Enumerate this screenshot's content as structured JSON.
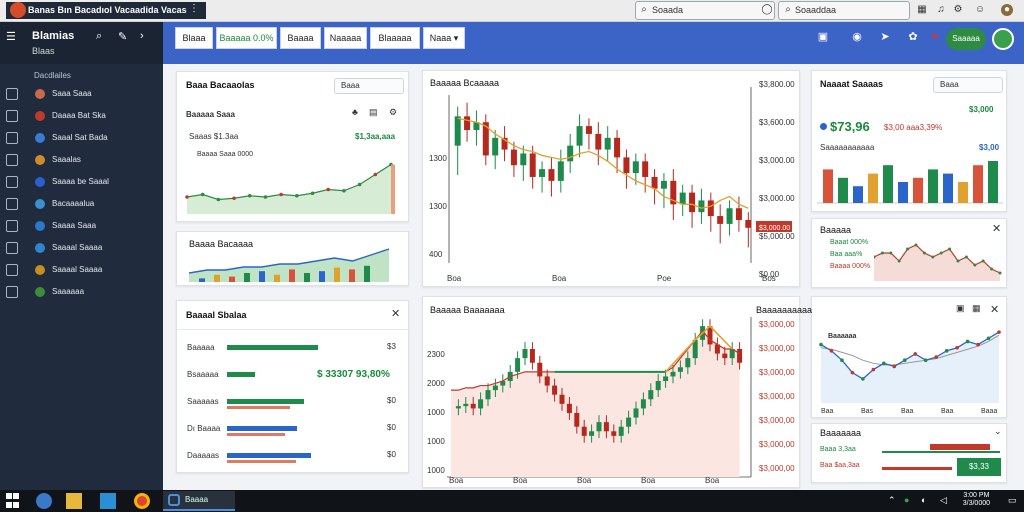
{
  "window": {
    "title": "Banas Bın Bacadıol Vacaadida Vacas"
  },
  "search": {
    "left": "Soaada",
    "right": "Soaaddaa"
  },
  "sidebar": {
    "title": "Blamias",
    "subtitle": "Blaas",
    "section": "Dacdlailes",
    "items": [
      {
        "label": "Saaa Saaa",
        "icon": "chart-icon",
        "color": "#c96a4a"
      },
      {
        "label": "Daaaa Bat Ska",
        "icon": "message-icon",
        "color": "#c0392b"
      },
      {
        "label": "Saaal Sat Bada",
        "icon": "key-icon",
        "color": "#3a7bd5"
      },
      {
        "label": "Saaalas",
        "icon": "calendar-icon",
        "color": "#d08a2a"
      },
      {
        "label": "Saaaa be Saaal",
        "icon": "bell-icon",
        "color": "#2c5fd0"
      },
      {
        "label": "Bacaaaalua",
        "icon": "grid-icon",
        "color": "#3a8fd0"
      },
      {
        "label": "Saaaa Saaa",
        "icon": "square-icon",
        "color": "#2a78c9"
      },
      {
        "label": "Saaaal Saaaa",
        "icon": "wrench-icon",
        "color": "#2d86cf"
      },
      {
        "label": "Saaaal Saaaa",
        "icon": "layers-icon",
        "color": "#c78f1f"
      },
      {
        "label": "Saaaaaa",
        "icon": "box-icon",
        "color": "#3e8d3a"
      }
    ]
  },
  "toolbar": {
    "tabs": [
      {
        "label": "Blaaa",
        "active": false
      },
      {
        "label": "Baaaaa 0.0%",
        "active": true
      },
      {
        "label": "Baaaa",
        "active": false
      },
      {
        "label": "Naaaaa",
        "active": false
      },
      {
        "label": "Blaaaaa",
        "active": false
      },
      {
        "label": "Naaa ▾",
        "active": false
      }
    ],
    "action_label": "Saaaaa",
    "icons": [
      "calendar-icon",
      "globe-icon",
      "send-icon",
      "leaf-icon"
    ]
  },
  "panel1": {
    "title": "Baaa Bacaaolas",
    "btn": "Baaa",
    "kpi_label": "Saaas $1.3aa",
    "kpi_value": "$1,3aa,aaa",
    "sub": "Baaaa Saaa 0000",
    "values": [
      12,
      14,
      10,
      11,
      13,
      12,
      14,
      13,
      15,
      18,
      17,
      22,
      30,
      38
    ]
  },
  "panel2": {
    "title": "Baaaa Bacaaaa",
    "bars": [
      2,
      4,
      3,
      5,
      6,
      4,
      7,
      5,
      6,
      8,
      7,
      9
    ],
    "line": [
      3,
      4,
      4,
      5,
      5,
      6,
      6,
      7,
      8,
      7,
      9,
      11
    ]
  },
  "panel3": {
    "title": "Baaaal Sbalaa",
    "rows": [
      {
        "label": "Baaaaa",
        "value": "$3",
        "pct": 0.65,
        "color": "#1e8a4b"
      },
      {
        "label": "Bsaaaaa",
        "value": "$ 33307 93,80%",
        "pct": 0.2,
        "color": "#1e8a4b"
      },
      {
        "label": "Saaaaas",
        "value": "$0",
        "pct": 0.55,
        "color": "#1e8a4b"
      },
      {
        "label": "Dı Baaaa",
        "value": "$0",
        "pct": 0.5,
        "color": "#2a66c9"
      },
      {
        "label": "Daaaaas",
        "value": "$0",
        "pct": 0.6,
        "color": "#2a66c9"
      }
    ]
  },
  "chart_main": {
    "title": "Baaaaa Bcaaaaa",
    "ylabels": [
      "$3,800.00",
      "$3,600.00",
      "$3,000.00",
      "$3,000.00",
      "$5,000.00",
      "$0.00"
    ],
    "left_labels": [
      "1300",
      "1300",
      "400",
      "0"
    ],
    "xlabels": [
      "Boa",
      "Boa",
      "Poe",
      "Bos"
    ],
    "price_tag": "$3,000.00",
    "candles": [
      [
        60,
        75,
        45,
        80
      ],
      [
        75,
        68,
        62,
        82
      ],
      [
        68,
        72,
        60,
        78
      ],
      [
        72,
        55,
        50,
        76
      ],
      [
        55,
        64,
        48,
        68
      ],
      [
        64,
        58,
        52,
        70
      ],
      [
        58,
        50,
        44,
        62
      ],
      [
        50,
        56,
        42,
        60
      ],
      [
        56,
        44,
        38,
        60
      ],
      [
        44,
        48,
        36,
        52
      ],
      [
        48,
        42,
        34,
        54
      ],
      [
        42,
        52,
        36,
        58
      ],
      [
        52,
        60,
        46,
        66
      ],
      [
        60,
        70,
        54,
        76
      ],
      [
        70,
        66,
        58,
        74
      ],
      [
        66,
        58,
        50,
        72
      ],
      [
        58,
        64,
        52,
        70
      ],
      [
        64,
        54,
        46,
        68
      ],
      [
        54,
        46,
        38,
        58
      ],
      [
        46,
        52,
        40,
        56
      ],
      [
        52,
        44,
        36,
        56
      ],
      [
        44,
        38,
        30,
        48
      ],
      [
        38,
        42,
        28,
        46
      ],
      [
        42,
        30,
        22,
        48
      ],
      [
        30,
        36,
        24,
        40
      ],
      [
        36,
        26,
        18,
        40
      ],
      [
        26,
        32,
        20,
        38
      ],
      [
        32,
        24,
        16,
        36
      ],
      [
        24,
        20,
        10,
        30
      ],
      [
        20,
        28,
        14,
        32
      ],
      [
        28,
        22,
        16,
        34
      ],
      [
        22,
        18,
        8,
        26
      ]
    ],
    "trend": [
      74,
      73,
      72,
      70,
      66,
      63,
      60,
      58,
      57,
      55,
      54,
      53,
      54,
      56,
      57,
      55,
      52,
      48,
      45,
      42,
      40,
      38,
      34,
      32,
      30,
      30,
      28,
      29,
      32,
      34,
      30,
      28
    ]
  },
  "chart_right1": {
    "title": "Naaaat Saaaas",
    "btn": "Baaa",
    "kpi_value": "$73,96",
    "kpi_change": "$3,00 aaa3,39%",
    "kpi_right": "$3,000",
    "sub": "Saaaaaaaaaaa",
    "sub_value": "$3,00",
    "bars": [
      {
        "value": 8,
        "color": "#d9533a"
      },
      {
        "value": 6,
        "color": "#1e8a4b"
      },
      {
        "value": 4,
        "color": "#2a66c9"
      },
      {
        "value": 7,
        "color": "#e1a12f"
      },
      {
        "value": 9,
        "color": "#1e8a4b"
      },
      {
        "value": 5,
        "color": "#2a66c9"
      },
      {
        "value": 6,
        "color": "#d9533a"
      },
      {
        "value": 8,
        "color": "#1e8a4b"
      },
      {
        "value": 7,
        "color": "#2a66c9"
      },
      {
        "value": 5,
        "color": "#e1a12f"
      },
      {
        "value": 9,
        "color": "#d9533a"
      },
      {
        "value": 10,
        "color": "#1e8a4b"
      }
    ]
  },
  "chart_right2": {
    "title": "Baaaaa",
    "lines": [
      "Baaat 000%",
      "Baa aaa%",
      "Baaaa 000%"
    ],
    "values": [
      6,
      7,
      7,
      5,
      8,
      9,
      7,
      6,
      7,
      8,
      5,
      6,
      4,
      5,
      3,
      2
    ]
  },
  "chart_bottom": {
    "title": "Baaaaa Baaaaaaa",
    "ylabels": [
      "$3,000,00",
      "$3,000,00",
      "$3,000,00",
      "$3,000,00",
      "$3,000,00",
      "$3,000,00",
      "$3,000,00"
    ],
    "left_labels": [
      "2300",
      "2000",
      "1000",
      "1000",
      "1000"
    ],
    "xlabels": [
      "Boa",
      "Boa",
      "Boa",
      "Boa",
      "Boa"
    ],
    "values": [
      30,
      31,
      32,
      30,
      34,
      38,
      40,
      42,
      46,
      52,
      56,
      50,
      44,
      40,
      36,
      32,
      28,
      22,
      18,
      20,
      24,
      20,
      18,
      22,
      26,
      30,
      34,
      38,
      42,
      44,
      46,
      48,
      52,
      60,
      66,
      58,
      54,
      52,
      56,
      50
    ],
    "avg": [
      38,
      38,
      39,
      39,
      40,
      40,
      41,
      42,
      44,
      45,
      46,
      46,
      46,
      46,
      46,
      46,
      46,
      46,
      46,
      46,
      46,
      46,
      46,
      46,
      46,
      46,
      46,
      46,
      46,
      46,
      48,
      52,
      56,
      60,
      64,
      60,
      58,
      56,
      56,
      54
    ]
  },
  "chart_right3": {
    "title": "Baaaaaaaaaa",
    "legend": "Baaaaaa",
    "xlabels": [
      "Baa",
      "Bas",
      "Baa",
      "Baa",
      "Baaa"
    ],
    "values": [
      40,
      36,
      30,
      22,
      18,
      24,
      28,
      26,
      30,
      34,
      30,
      32,
      36,
      38,
      42,
      40,
      44,
      48
    ],
    "trend": [
      38,
      37,
      35,
      33,
      30,
      28,
      27,
      27,
      28,
      29,
      30,
      31,
      33,
      35,
      37,
      39,
      42,
      46
    ]
  },
  "panel_right4": {
    "title": "Baaaaaaa",
    "line1": "Baaa 3,3aa",
    "line2": "Baa $aa,3aa",
    "btn": "$3,33"
  },
  "taskbar": {
    "active_app": "Baaaa",
    "clock_time": "3:00 PM",
    "clock_date": "3/3/0000"
  },
  "colors": {
    "accent": "#3c63c6",
    "green": "#1e8a4b",
    "red": "#c0392b",
    "sidebar": "#202c3d"
  }
}
